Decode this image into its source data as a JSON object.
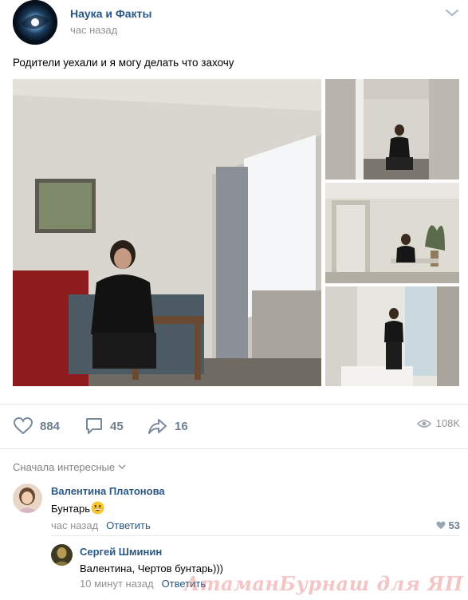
{
  "post": {
    "group_name": "Наука и Факты",
    "time": "час назад",
    "text": "Родители уехали и я могу делать что захочу"
  },
  "actions": {
    "likes": "884",
    "comments": "45",
    "shares": "16",
    "views": "108K"
  },
  "comments_section": {
    "sort_label": "Сначала интересные",
    "items": [
      {
        "author": "Валентина Платонова",
        "text": "Бунтарь",
        "time": "час назад",
        "reply": "Ответить",
        "likes": "53"
      },
      {
        "author": "Сергей Шминин",
        "text": "Валентина, Чертов бунтарь)))",
        "time": "10 минут назад",
        "reply": "Ответить"
      }
    ]
  },
  "watermark": "АтаманБурнаш для ЯП",
  "colors": {
    "link": "#2a5885",
    "muted": "#939393",
    "icon": "#6e7f92",
    "divider": "#e7e8ec"
  }
}
